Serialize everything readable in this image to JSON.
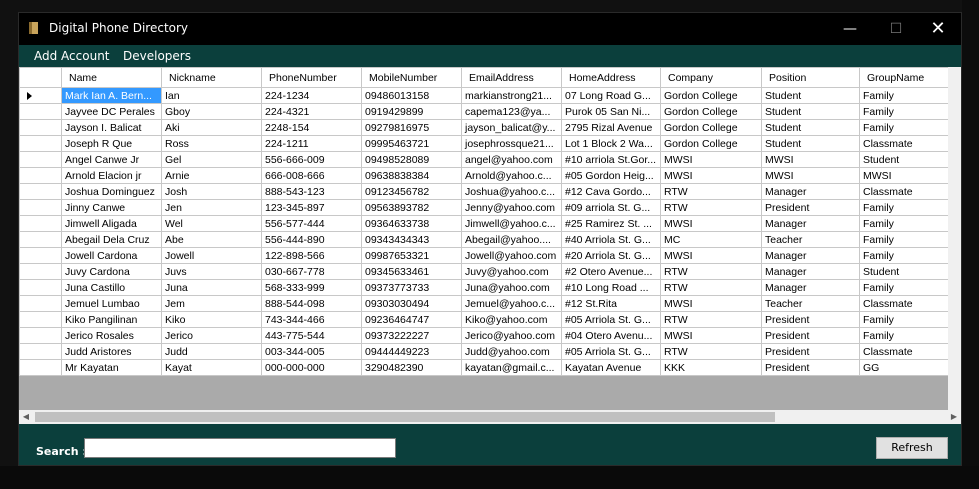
{
  "window": {
    "title": "Digital Phone Directory",
    "minimize": "—",
    "maximize": "☐",
    "close": "✕"
  },
  "menu": {
    "add_account": "Add Account",
    "developers": "Developers"
  },
  "grid": {
    "columns": [
      "Name",
      "Nickname",
      "PhoneNumber",
      "MobileNumber",
      "EmailAddress",
      "HomeAddress",
      "Company",
      "Position",
      "GroupName"
    ],
    "rows": [
      [
        "Mark Ian A. Bern...",
        "Ian",
        "224-1234",
        "09486013158",
        "markianstrong21...",
        "07 Long Road G...",
        "Gordon College",
        "Student",
        "Family"
      ],
      [
        "Jayvee DC Perales",
        "Gboy",
        "224-4321",
        "0919429899",
        "capema123@ya...",
        "Purok 05 San Ni...",
        "Gordon College",
        "Student",
        "Family"
      ],
      [
        "Jayson I. Balicat",
        "Aki",
        "2248-154",
        "09279816975",
        "jayson_balicat@y...",
        "2795 Rizal Avenue",
        "Gordon College",
        "Student",
        "Family"
      ],
      [
        "Joseph R Que",
        "Ross",
        "224-1211",
        "09995463721",
        "josephrossque21...",
        "Lot 1 Block 2 Wa...",
        "Gordon College",
        "Student",
        "Classmate"
      ],
      [
        "Angel Canwe Jr",
        "Gel",
        "556-666-009",
        "09498528089",
        "angel@yahoo.com",
        "#10 arriola St.Gor...",
        "MWSI",
        "MWSI",
        "Student"
      ],
      [
        "Arnold Elacion jr",
        "Arnie",
        "666-008-666",
        "09638838384",
        "Arnold@yahoo.c...",
        "#05 Gordon Heig...",
        "MWSI",
        "MWSI",
        "MWSI"
      ],
      [
        "Joshua Dominguez",
        "Josh",
        "888-543-123",
        "09123456782",
        "Joshua@yahoo.c...",
        "#12 Cava Gordo...",
        "RTW",
        "Manager",
        "Classmate"
      ],
      [
        "Jinny Canwe",
        "Jen",
        "123-345-897",
        "09563893782",
        "Jenny@yahoo.com",
        "#09 arriola St. G...",
        "RTW",
        "President",
        "Family"
      ],
      [
        "Jimwell Aligada",
        "Wel",
        "556-577-444",
        "09364633738",
        "Jimwell@yahoo.c...",
        "#25 Ramirez St. ...",
        "MWSI",
        "Manager",
        "Family"
      ],
      [
        "Abegail Dela Cruz",
        "Abe",
        "556-444-890",
        "09343434343",
        "Abegail@yahoo....",
        "#40 Arriola St. G...",
        "MC",
        "Teacher",
        "Family"
      ],
      [
        "Jowell Cardona",
        "Jowell",
        "122-898-566",
        "09987653321",
        "Jowell@yahoo.com",
        "#20 Arriola St. G...",
        "MWSI",
        "Manager",
        "Family"
      ],
      [
        "Juvy Cardona",
        "Juvs",
        "030-667-778",
        "09345633461",
        "Juvy@yahoo.com",
        "#2 Otero Avenue...",
        "RTW",
        "Manager",
        "Student"
      ],
      [
        "Juna Castillo",
        "Juna",
        "568-333-999",
        "09373773733",
        "Juna@yahoo.com",
        "#10 Long Road ...",
        "RTW",
        "Manager",
        "Family"
      ],
      [
        "Jemuel Lumbao",
        "Jem",
        "888-544-098",
        "09303030494",
        "Jemuel@yahoo.c...",
        "#12 St.Rita",
        "MWSI",
        "Teacher",
        "Classmate"
      ],
      [
        "Kiko Pangilinan",
        "Kiko",
        "743-344-466",
        "09236464747",
        "Kiko@yahoo.com",
        "#05 Arriola St. G...",
        "RTW",
        "President",
        "Family"
      ],
      [
        "Jerico Rosales",
        "Jerico",
        "443-775-544",
        "09373222227",
        "Jerico@yahoo.com",
        "#04 Otero Avenu...",
        "MWSI",
        "President",
        "Family"
      ],
      [
        "Judd Aristores",
        "Judd",
        "003-344-005",
        "09444449223",
        "Judd@yahoo.com",
        "#05 Arriola St. G...",
        "RTW",
        "President",
        "Classmate"
      ],
      [
        "Mr Kayatan",
        "Kayat",
        "000-000-000",
        "3290482390",
        "kayatan@gmail.c...",
        "Kayatan Avenue",
        "KKK",
        "President",
        "GG"
      ]
    ]
  },
  "scroll": {
    "left": "◀",
    "right": "▶"
  },
  "search": {
    "label": "Search :",
    "value": ""
  },
  "refresh_label": "Refresh",
  "colors": {
    "menubar": "#0b3f3c",
    "titlebar": "#000000",
    "selection": "#3399ff"
  }
}
